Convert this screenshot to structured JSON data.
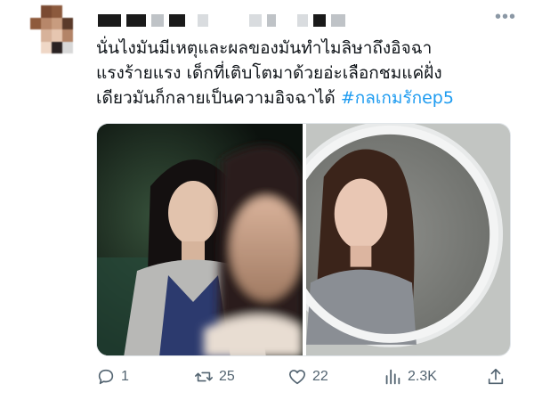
{
  "tweet": {
    "text_line1": "นั่นไงมันมีเหตุและผลของมันทำไมลิษาถึงอิจฉา",
    "text_line2": "แรงร้ายแรง เด็กที่เติบโตมาด้วยอ่ะเลือกชมแค่ฝั่ง",
    "text_line3": "เดียวมันก็กลายเป็นความอิจฉาได้",
    "hashtag": "#กลเกมรักep5"
  },
  "actions": {
    "replies": "1",
    "retweets": "25",
    "likes": "22",
    "views": "2.3K"
  },
  "icons": {
    "more": "more-dots-icon",
    "reply": "reply-icon",
    "retweet": "retweet-icon",
    "like": "heart-icon",
    "views": "views-chart-icon",
    "share": "share-icon"
  },
  "colors": {
    "hashtag": "#1d9bf0",
    "action_gray": "#536471"
  }
}
